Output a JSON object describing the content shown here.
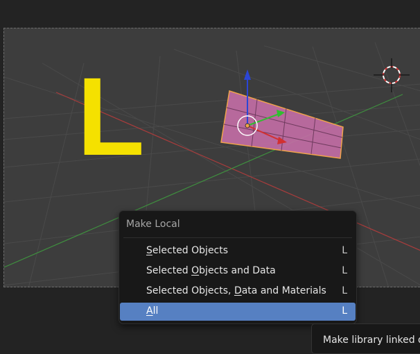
{
  "viewport": {
    "overlay_text": "L",
    "overlay_color": "#f5e100",
    "mesh_color": "#c46ea6",
    "axis_x_color": "#a83c3c",
    "axis_y_color": "#3f8f3f"
  },
  "menu": {
    "title": "Make Local",
    "items": [
      {
        "pre": "",
        "key": "S",
        "post": "elected Objects",
        "shortcut": "L",
        "active": false
      },
      {
        "pre": "Selected ",
        "key": "O",
        "post": "bjects and Data",
        "shortcut": "L",
        "active": false
      },
      {
        "pre": "Selected Objects, ",
        "key": "D",
        "post": "ata and Materials",
        "shortcut": "L",
        "active": false
      },
      {
        "pre": "",
        "key": "A",
        "post": "ll",
        "shortcut": "L",
        "active": true
      }
    ]
  },
  "tooltip": {
    "text": "Make library linked d"
  }
}
